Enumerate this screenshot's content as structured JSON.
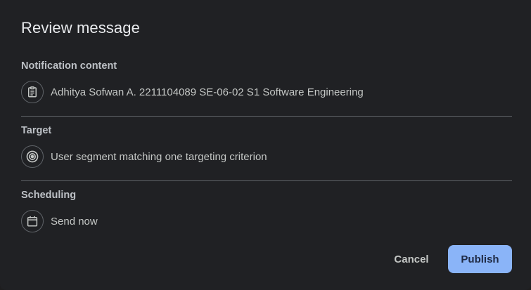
{
  "dialog": {
    "title": "Review message"
  },
  "sections": [
    {
      "heading": "Notification content",
      "icon": "clipboard-icon",
      "text": "Adhitya Sofwan A. 2211104089 SE-06-02 S1 Software Engineering"
    },
    {
      "heading": "Target",
      "icon": "target-icon",
      "text": "User segment matching one targeting criterion"
    },
    {
      "heading": "Scheduling",
      "icon": "calendar-icon",
      "text": "Send now"
    }
  ],
  "actions": {
    "cancel_label": "Cancel",
    "publish_label": "Publish"
  },
  "colors": {
    "background": "#202124",
    "primary_button": "#8ab4f8",
    "divider": "#5f6368"
  }
}
